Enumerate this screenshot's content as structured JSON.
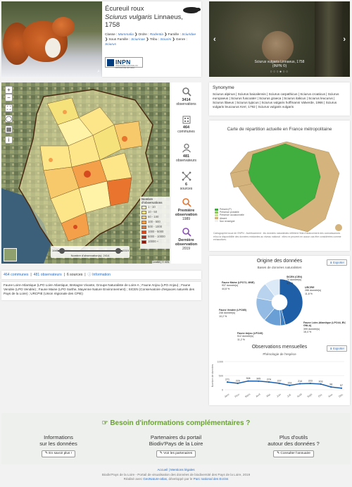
{
  "species": {
    "common_name": "Écureuil roux",
    "latin_name": "Sciurus vulgaris",
    "author": "Linnaeus,",
    "year": "1758",
    "taxonomy": {
      "classe_label": "Classe :",
      "classe": "Mammalia",
      "ordre_label": "Ordre :",
      "ordre": "Rodentia",
      "famille_label": "Famille :",
      "famille": "Sciuridae",
      "sous_famille_label": "Sous Famille :",
      "sous_famille": "Sciurinae",
      "tribu_label": "Tribu :",
      "tribu": "Sciurini",
      "genre_label": "Genre :",
      "genre": "Sciurus"
    },
    "inpn_logo": "INPN",
    "inpn_sub": "INVENTAIRE NATIONAL DU PATRIMOINE NATUREL"
  },
  "carousel": {
    "caption_line1": "Sciurus vulgaris Linnaeus, 1758",
    "caption_line2": "(INPN ©)",
    "prev_icon": "‹",
    "next_icon": "›",
    "dots": "○○○●○○"
  },
  "map": {
    "zoom_in": "+",
    "zoom_out": "−",
    "legend_title": "Nombre d'observations",
    "legend_items": [
      {
        "label": "1 - 10",
        "color": "#fff7b0"
      },
      {
        "label": "10 - 50",
        "color": "#fde68a"
      },
      {
        "label": "50 - 100",
        "color": "#f8c96a"
      },
      {
        "label": "100 - 500",
        "color": "#f4a04a"
      },
      {
        "label": "500 - 1000",
        "color": "#e8742e"
      },
      {
        "label": "1000 - 5000",
        "color": "#d54a1f"
      },
      {
        "label": "5000 - 10000",
        "color": "#b52a12"
      },
      {
        "label": "10000 +",
        "color": "#8a1608"
      }
    ],
    "slider_start": "1989",
    "slider_end": "2019",
    "slider_label": "Nombre d'observation(s): 2414",
    "attribution": "Leaflet | © IGN"
  },
  "stats": {
    "observations_value": "3414",
    "observations_label": "observations",
    "communes_value": "464",
    "communes_label": "communes",
    "observateurs_value": "481",
    "observateurs_label": "observateurs",
    "sources_value": "6",
    "sources_label": "sources",
    "premiere_label1": "Première",
    "premiere_label2": "observation",
    "premiere_value": "1989",
    "derniere_label1": "Dernière",
    "derniere_label2": "observation",
    "derniere_value": "2019"
  },
  "synonyme": {
    "title": "Synonyme",
    "text": "Sciurus alpinus | Sciurus baicalensis | Sciurus carpathicus | Sciurus croaticus | Sciurus europaeus | Sciurus fuscoater | Sciurus graeca | Sciurus italicus | Sciurus leucurus | Sciurus lilaeus | Sciurus typicus | Sciurus vulgaris hoffmanni Valverde, 1966 | Sciurus vulgaris leucourus Kerr, 1792 | Sciurus vulgaris vulgaris"
  },
  "france": {
    "title": "Carte de répartition actuelle en France métropolitaine",
    "legend": [
      {
        "label": "Présent (P)",
        "color": "#3fae3f"
      },
      {
        "label": "Présence probable",
        "color": "#90c95c"
      },
      {
        "label": "Présence occasionnelle",
        "color": "#c9e39b"
      },
      {
        "label": "Absent",
        "color": "#d4b47c"
      },
      {
        "label": "Non renseigné",
        "color": "#efefef"
      }
    ],
    "note": "Cartographie issue de l'INPN - Avertissement : les données naturalistes reflètent l'état d'avancement des connaissances et/ou la disponibilité des données existantes au niveau national : elles ne peuvent en aucun cas être considérées comme exhaustives."
  },
  "counts": {
    "communes": "464 communes",
    "observateurs": "481 observateurs",
    "sources": "6 sources",
    "information": "Information"
  },
  "sources_text": "Faune Loire-Atlantique (LPO Loire Atlantique, Bretagne Vivante, Groupe Naturaliste de Loire-A ; Faune Anjou (LPO Anjou) ; Faune Vendée (LPO Vendée) ; Faune Maine (LPO Sarthe, Mayenne Nature Environnement) ; SICEN (Conservatoire d'espaces naturels des Pays de la Loire) ; URCPIE (Union régionale des CPIE)",
  "origin": {
    "title": "Origine des données",
    "subtitle": "Bases de données naturalistes",
    "export_label": "Exporter",
    "slices": [
      {
        "name": "Faune Maine (LPO72, MNE)",
        "count": "937 donnée(s)",
        "pct": "44,8 %",
        "color": "#1f5fa8",
        "value": 44.8
      },
      {
        "name": "SICEN (CEN)",
        "count": "74 donnée(s)",
        "pct": "3,1 %",
        "color": "#3d7fc3",
        "value": 3.1
      },
      {
        "name": "URCPIE",
        "count": "286 donnée(s)",
        "pct": "11,8 %",
        "color": "#6a9fd6",
        "value": 11.8
      },
      {
        "name": "Faune Loire-Atlantique (LPO44, BV, GNLA)",
        "count": "399 donnée(s)",
        "pct": "16,4 %",
        "color": "#93bbe4",
        "value": 16.4
      },
      {
        "name": "Faune Anjou (LPO49)",
        "count": "512 donnée(s)",
        "pct": "11,2 %",
        "color": "#b9d3ef",
        "value": 11.2
      },
      {
        "name": "Faune Vendée (LPO85)",
        "count": "246 donnée(s)",
        "pct": "10,2 %",
        "color": "#dce9f7",
        "value": 10.2
      }
    ],
    "monthly_title": "Observations mensuelles",
    "monthly_subtitle": "Phénologie de l'espèce",
    "monthly_export": "Exporter"
  },
  "chart_data": {
    "type": "line",
    "title": "Observations mensuelles",
    "subtitle": "Phénologie de l'espèce",
    "ylabel": "Nombre de données",
    "categories": [
      "Janv.",
      "Févr.",
      "Mars",
      "Avril",
      "Mai",
      "Juin",
      "Juil.",
      "Août",
      "Sept.",
      "Oct.",
      "Nov.",
      "Déc."
    ],
    "values": [
      271,
      229,
      308,
      305,
      274,
      227,
      153,
      214,
      223,
      203,
      98,
      57
    ],
    "value_labels": [
      "271",
      "229",
      "308",
      "305",
      "274",
      "227",
      "153",
      "214",
      "223",
      "203",
      "98",
      "57"
    ],
    "ylim": [
      0,
      1000
    ],
    "yticks": [
      "1000",
      "500",
      "0"
    ],
    "color": "#1f5fa8"
  },
  "banner": {
    "title": "Besoin d'informations complémentaires ?",
    "col1_line1": "Informations",
    "col1_line2": "sur les données",
    "col1_button": "En savoir plus !",
    "col2_line1": "Partenaires du portail",
    "col2_line2": "Biodiv'Pays de la Loire",
    "col2_button": "Voir les partenaires",
    "col3_line1": "Plus d'outils",
    "col3_line2": "autour des données ?",
    "col3_button": "Consulter l'annuaire"
  },
  "footer": {
    "links": "Accueil | Mentions légales",
    "line2": "Biodiv'Pays de la Loire - Portail de visualisation des données de biodiversité des Pays de la Loire, 2019",
    "line3_prefix": "Réalisé avec",
    "geonature": "GeoNature-atlas",
    "line3_mid": ", développé par le",
    "parc": "Parc national des Ecrins"
  }
}
